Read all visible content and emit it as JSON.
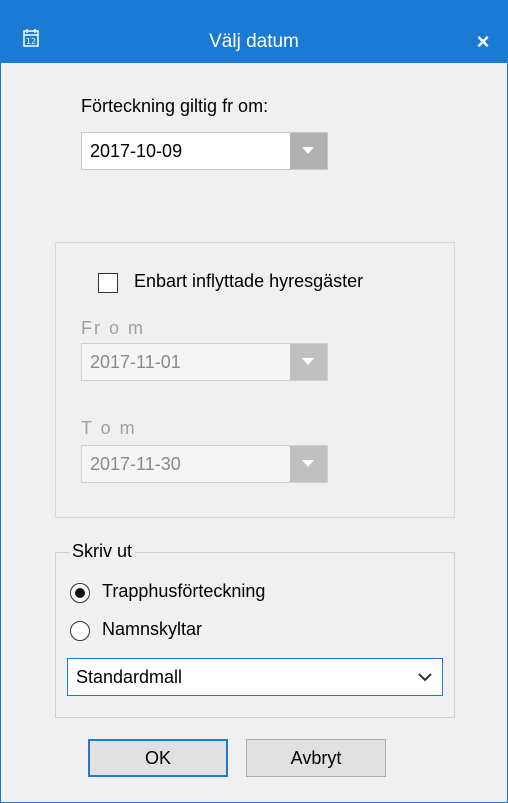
{
  "window": {
    "title": "Välj datum",
    "icon": "calendar-icon",
    "close_label": "×"
  },
  "valid_from": {
    "label": "Förteckning giltig fr om:",
    "value": "2017-10-09"
  },
  "filter_panel": {
    "checkbox_label": "Enbart inflyttade hyresgäster",
    "checked": false,
    "from_label": "Fr o m",
    "from_value": "2017-11-01",
    "to_label": "T o m",
    "to_value": "2017-11-30"
  },
  "print_group": {
    "title": "Skriv ut",
    "options": [
      {
        "label": "Trapphusförteckning",
        "selected": true
      },
      {
        "label": "Namnskyltar",
        "selected": false
      }
    ],
    "template_value": "Standardmall"
  },
  "buttons": {
    "ok": "OK",
    "cancel": "Avbryt"
  },
  "colors": {
    "accent": "#1a7ad4",
    "background": "#f0f0f0",
    "disabled_text": "#a0a0a0"
  }
}
